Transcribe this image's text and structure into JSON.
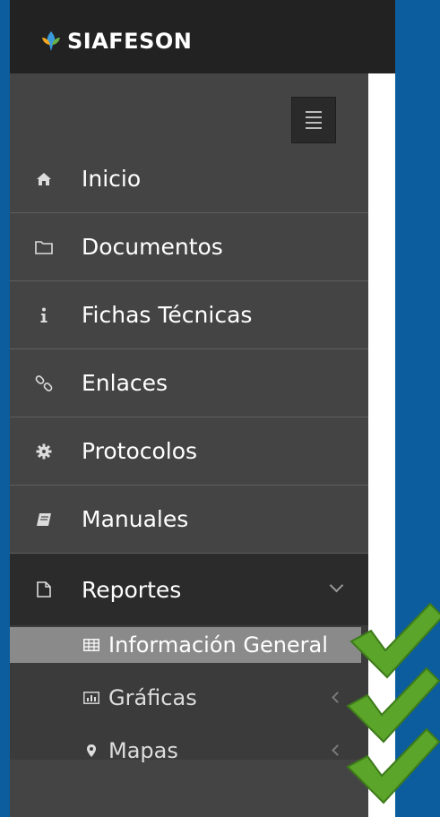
{
  "brand": {
    "name": "SIAFESON"
  },
  "menu": {
    "items": [
      {
        "label": "Inicio",
        "icon": "home-icon"
      },
      {
        "label": "Documentos",
        "icon": "folder-icon"
      },
      {
        "label": "Fichas Técnicas",
        "icon": "info-icon"
      },
      {
        "label": "Enlaces",
        "icon": "link-icon"
      },
      {
        "label": "Protocolos",
        "icon": "gear-icon"
      },
      {
        "label": "Manuales",
        "icon": "book-icon"
      },
      {
        "label": "Reportes",
        "icon": "file-icon"
      }
    ],
    "subitems": [
      {
        "label": "Información General",
        "icon": "table-icon"
      },
      {
        "label": "Gráficas",
        "icon": "bar-chart-icon"
      },
      {
        "label": "Mapas",
        "icon": "map-marker-icon"
      }
    ]
  },
  "colors": {
    "background": "#0b5d9e",
    "topbar": "#222222",
    "sidebar": "#444444",
    "selected": "#8a8a8a",
    "check": "#5aa52a"
  }
}
